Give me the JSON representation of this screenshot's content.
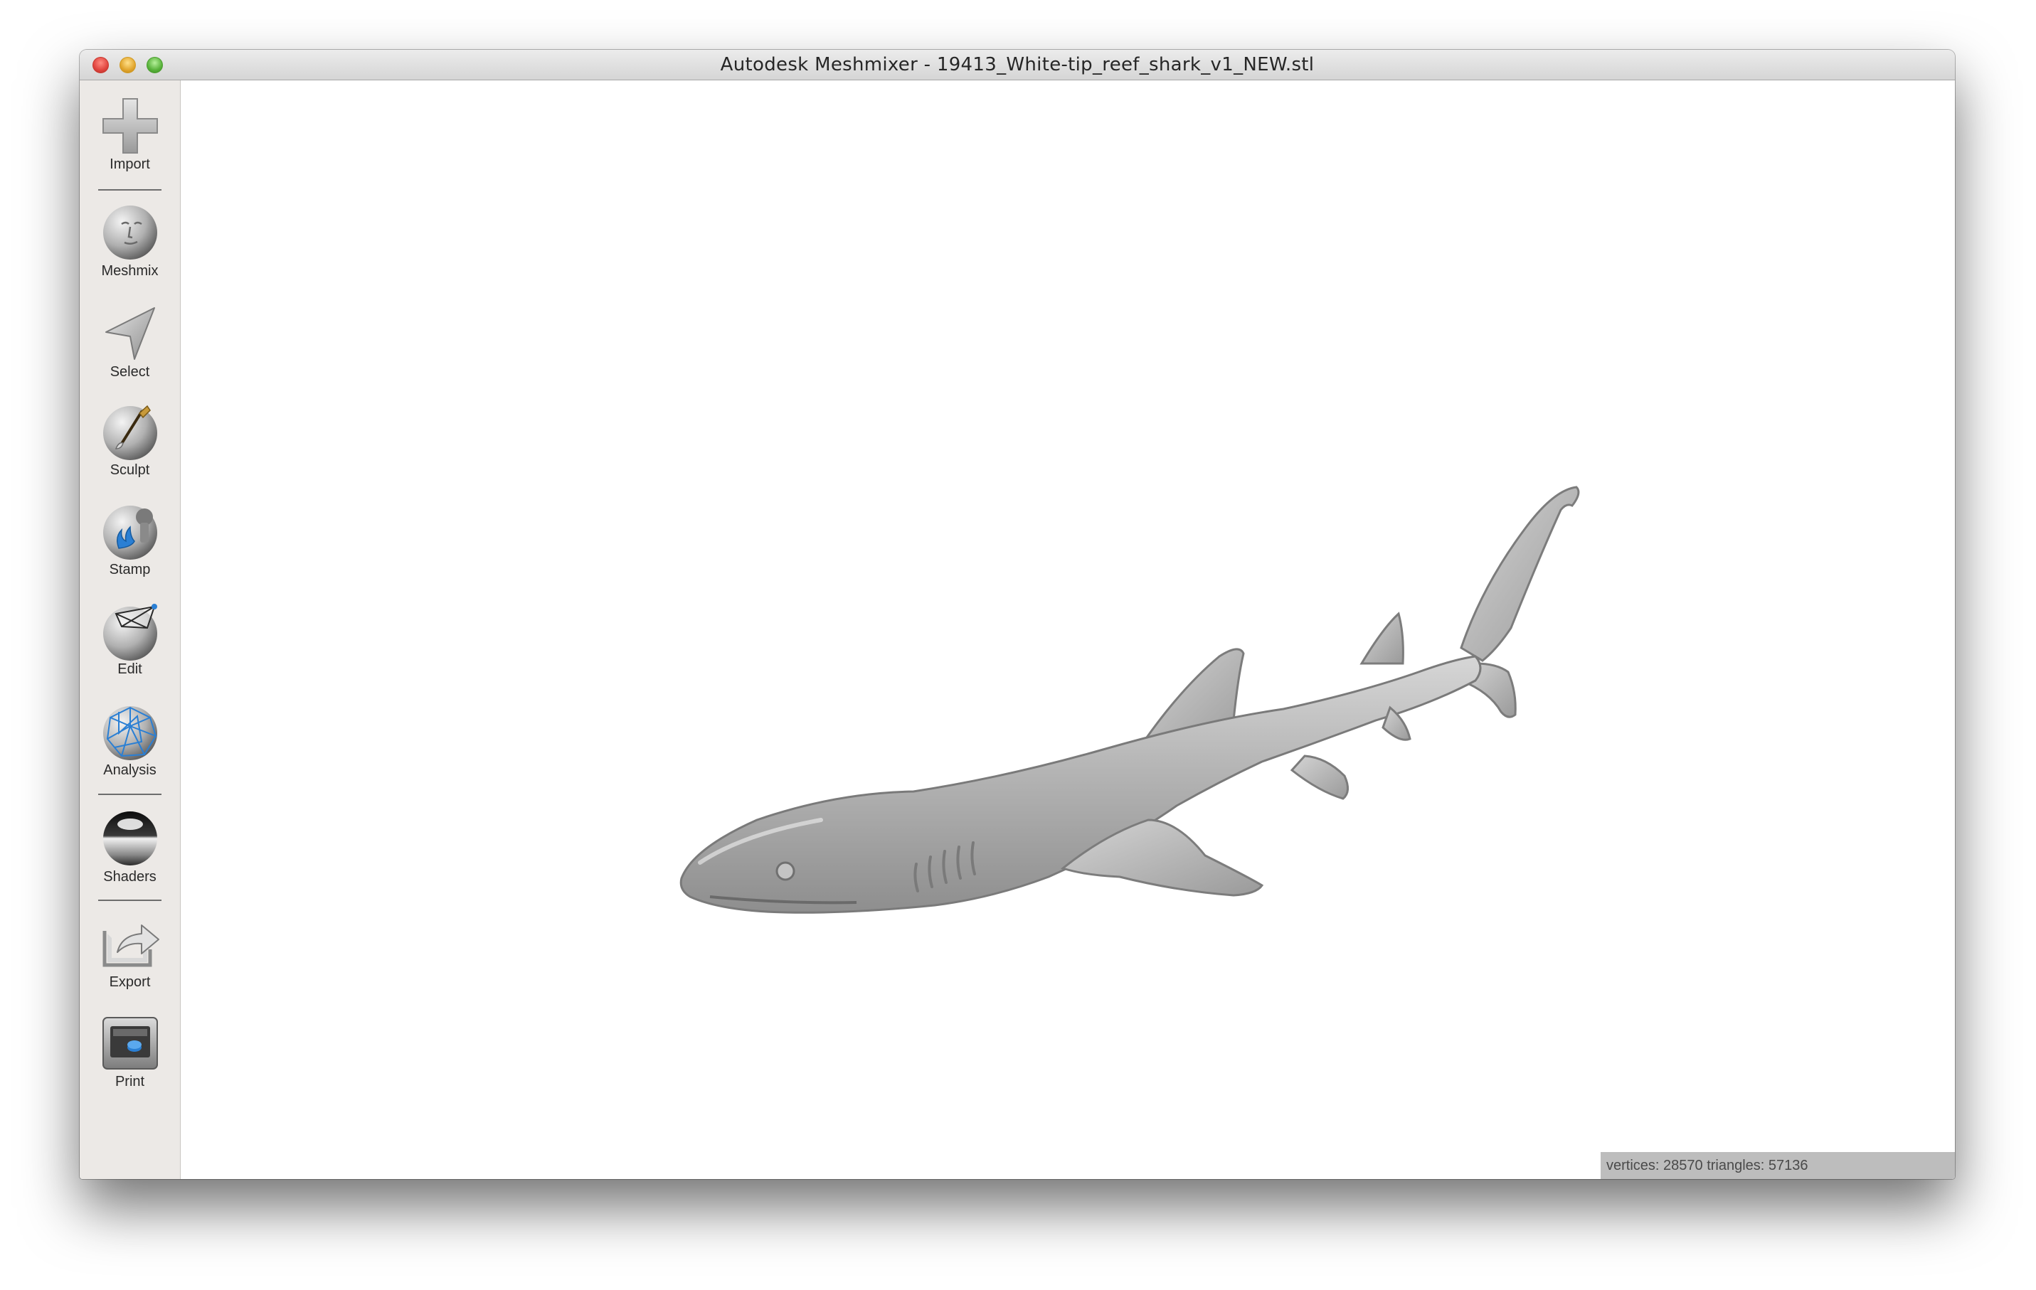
{
  "window": {
    "title": "Autodesk Meshmixer - 19413_White-tip_reef_shark_v1_NEW.stl"
  },
  "toolbar": {
    "items": [
      {
        "label": "Import",
        "icon": "plus-icon"
      },
      {
        "label": "Meshmix",
        "icon": "face-sphere-icon"
      },
      {
        "label": "Select",
        "icon": "arrow-cursor-icon"
      },
      {
        "label": "Sculpt",
        "icon": "brush-sphere-icon"
      },
      {
        "label": "Stamp",
        "icon": "stamp-sphere-icon"
      },
      {
        "label": "Edit",
        "icon": "edit-sphere-icon"
      },
      {
        "label": "Analysis",
        "icon": "mesh-sphere-icon"
      },
      {
        "label": "Shaders",
        "icon": "chrome-sphere-icon"
      },
      {
        "label": "Export",
        "icon": "export-icon"
      },
      {
        "label": "Print",
        "icon": "printer-icon"
      }
    ]
  },
  "viewport": {
    "model": "shark-mesh"
  },
  "status": {
    "text": "vertices: 28570 triangles: 57136"
  }
}
